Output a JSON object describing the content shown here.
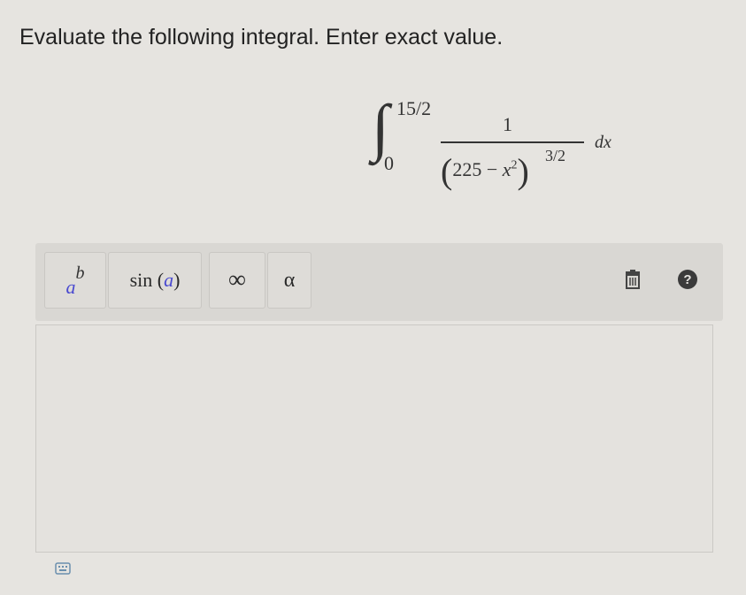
{
  "prompt": "Evaluate the following integral. Enter exact value.",
  "integral": {
    "lower": "0",
    "upper": "15/2",
    "numerator": "1",
    "denom_const": "225",
    "denom_minus": "−",
    "denom_var": "x",
    "denom_var_exp": "2",
    "outer_exp": "3/2",
    "differential": "dx"
  },
  "toolbar": {
    "power": {
      "base": "a",
      "exp": "b"
    },
    "sin": {
      "func": "sin",
      "arg": "a"
    },
    "infinity": "∞",
    "alpha": "α",
    "help": "?"
  },
  "icons": {
    "trash": "trash-icon",
    "help": "help-icon",
    "keyboard": "keyboard-icon"
  }
}
